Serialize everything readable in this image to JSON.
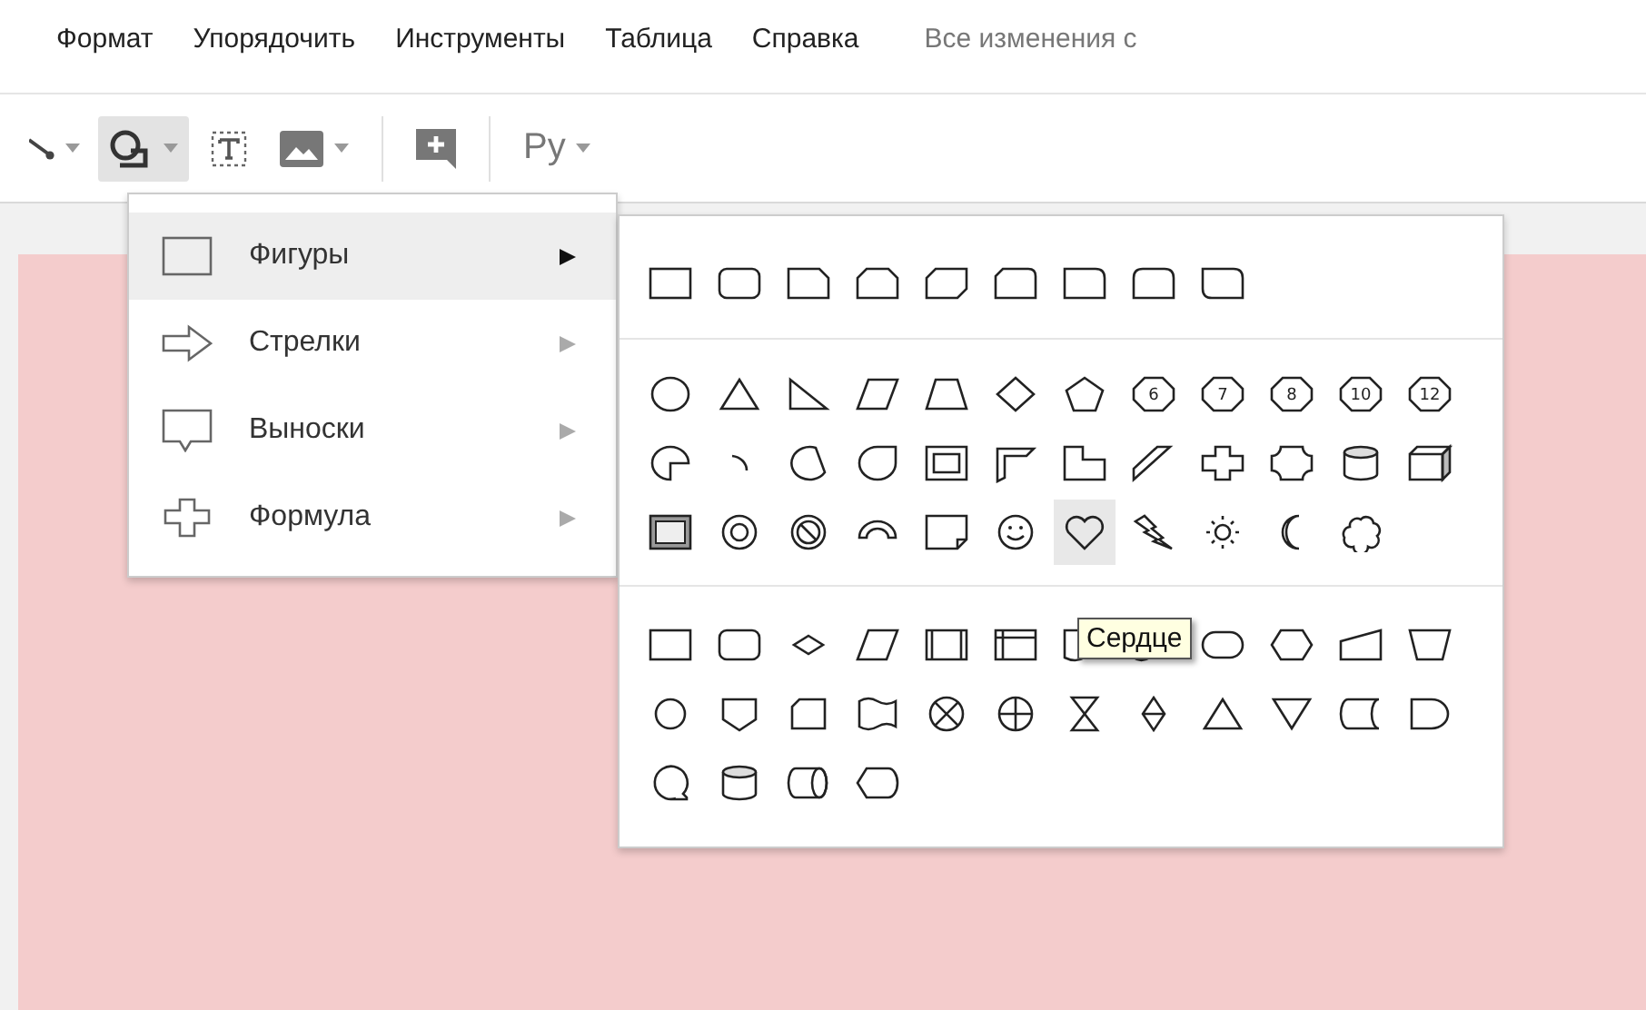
{
  "menu_bar": {
    "items": [
      "Формат",
      "Упорядочить",
      "Инструменты",
      "Таблица",
      "Справка"
    ],
    "save_status": "Все изменения с"
  },
  "toolbar": [
    {
      "kind": "line",
      "active": false,
      "caret": true
    },
    {
      "kind": "shape",
      "active": true,
      "caret": true
    },
    {
      "kind": "textbox",
      "active": false,
      "caret": false
    },
    {
      "kind": "image",
      "active": false,
      "caret": true
    },
    {
      "kind": "comment",
      "active": false,
      "caret": false
    },
    {
      "kind": "input",
      "active": false,
      "caret": true,
      "label": "Ру"
    }
  ],
  "insert_menu": {
    "items": [
      {
        "kind": "rect",
        "label": "Фигуры",
        "selected": true
      },
      {
        "kind": "arrow",
        "label": "Стрелки",
        "selected": false
      },
      {
        "kind": "callout",
        "label": "Выноски",
        "selected": false
      },
      {
        "kind": "plus",
        "label": "Формула",
        "selected": false
      }
    ]
  },
  "shape_sections": [
    {
      "shapes": [
        {
          "kind": "rect",
          "hovered": false
        },
        {
          "kind": "roundrect",
          "hovered": false
        },
        {
          "kind": "snip1",
          "hovered": false
        },
        {
          "kind": "snip2same",
          "hovered": false
        },
        {
          "kind": "snip2diag",
          "hovered": false
        },
        {
          "kind": "sniprounded",
          "hovered": false
        },
        {
          "kind": "round1",
          "hovered": false
        },
        {
          "kind": "round2same",
          "hovered": false
        },
        {
          "kind": "round2diag",
          "hovered": false
        }
      ]
    },
    {
      "shapes": [
        {
          "kind": "ellipse",
          "hovered": false
        },
        {
          "kind": "triangle",
          "hovered": false
        },
        {
          "kind": "rtriangle",
          "hovered": false
        },
        {
          "kind": "parallelogram",
          "hovered": false
        },
        {
          "kind": "trapezoid",
          "hovered": false
        },
        {
          "kind": "diamond",
          "hovered": false
        },
        {
          "kind": "pentagon",
          "hovered": false
        },
        {
          "kind": "polygon",
          "label": "6",
          "hovered": false
        },
        {
          "kind": "polygon",
          "label": "7",
          "hovered": false
        },
        {
          "kind": "polygon",
          "label": "8",
          "hovered": false
        },
        {
          "kind": "polygon",
          "label": "10",
          "hovered": false
        },
        {
          "kind": "polygon",
          "label": "12",
          "hovered": false
        },
        {
          "kind": "pie",
          "hovered": false
        },
        {
          "kind": "arc",
          "hovered": false
        },
        {
          "kind": "chord",
          "hovered": false
        },
        {
          "kind": "teardrop",
          "hovered": false
        },
        {
          "kind": "frame",
          "hovered": false
        },
        {
          "kind": "halfframe",
          "hovered": false
        },
        {
          "kind": "lshape",
          "hovered": false
        },
        {
          "kind": "diagstripe",
          "hovered": false
        },
        {
          "kind": "cross",
          "hovered": false
        },
        {
          "kind": "plaque",
          "hovered": false
        },
        {
          "kind": "can",
          "hovered": false
        },
        {
          "kind": "cube",
          "hovered": false
        },
        {
          "kind": "bevel",
          "hovered": false
        },
        {
          "kind": "donut",
          "hovered": false
        },
        {
          "kind": "nosymbol",
          "hovered": false
        },
        {
          "kind": "blockarc",
          "hovered": false
        },
        {
          "kind": "foldedcorner",
          "hovered": false
        },
        {
          "kind": "smiley",
          "hovered": false
        },
        {
          "kind": "heart",
          "hovered": true
        },
        {
          "kind": "lightning",
          "hovered": false
        },
        {
          "kind": "sun",
          "hovered": false
        },
        {
          "kind": "moon",
          "hovered": false
        },
        {
          "kind": "cloud",
          "hovered": false
        }
      ]
    },
    {
      "shapes": [
        {
          "kind": "rect",
          "hovered": false
        },
        {
          "kind": "roundrect",
          "hovered": false
        },
        {
          "kind": "decision",
          "hovered": false
        },
        {
          "kind": "parallelogram",
          "hovered": false
        },
        {
          "kind": "predefined",
          "hovered": false
        },
        {
          "kind": "internalstorage",
          "hovered": false
        },
        {
          "kind": "document",
          "hovered": false
        },
        {
          "kind": "multidocument",
          "hovered": false
        },
        {
          "kind": "terminator",
          "hovered": false
        },
        {
          "kind": "preparation",
          "hovered": false
        },
        {
          "kind": "manualinput",
          "hovered": false
        },
        {
          "kind": "manualop",
          "hovered": false
        },
        {
          "kind": "connector",
          "hovered": false
        },
        {
          "kind": "offpage",
          "hovered": false
        },
        {
          "kind": "punchedcard",
          "hovered": false
        },
        {
          "kind": "punchedtape",
          "hovered": false
        },
        {
          "kind": "summing",
          "hovered": false
        },
        {
          "kind": "or",
          "hovered": false
        },
        {
          "kind": "collate",
          "hovered": false
        },
        {
          "kind": "sort",
          "hovered": false
        },
        {
          "kind": "extract",
          "hovered": false
        },
        {
          "kind": "merge",
          "hovered": false
        },
        {
          "kind": "storeddata",
          "hovered": false
        },
        {
          "kind": "delay",
          "hovered": false
        },
        {
          "kind": "seqaccess",
          "hovered": false
        },
        {
          "kind": "can",
          "hovered": false
        },
        {
          "kind": "directaccess",
          "hovered": false
        },
        {
          "kind": "display",
          "hovered": false
        }
      ]
    }
  ],
  "tooltip": {
    "text": "Сердце"
  }
}
